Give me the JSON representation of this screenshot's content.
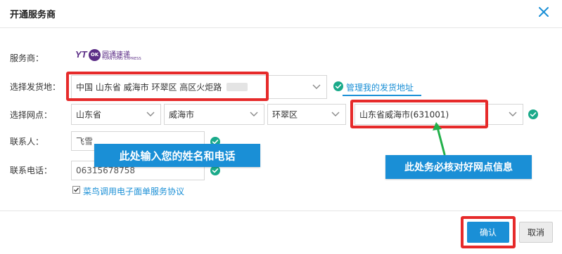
{
  "dialog": {
    "title": "开通服务商",
    "close_icon": "close-icon"
  },
  "form": {
    "provider_label": "服务商：",
    "provider_logo": {
      "mark": "YT",
      "badge": "OK",
      "cn_text": "圆通速递",
      "sub_text": "YUANTONG EXPRESS",
      "brand_color": "#5b2d86"
    },
    "origin_label": "选择发货地：",
    "origin_value": "中国 山东省 威海市 环翠区 高区火炬路",
    "manage_address_link": "管理我的发货地址",
    "branch_label": "选择网点：",
    "branch_province": "山东省",
    "branch_city": "威海市",
    "branch_district": "环翠区",
    "branch_outlet": "山东省威海市(631001)",
    "contact_label": "联系人：",
    "contact_value": "飞雪",
    "phone_label": "联系电话：",
    "phone_value": "06315678758",
    "agreement_checked": true,
    "agreement_text": "菜鸟调用电子面单服务协议"
  },
  "annotations": {
    "name_phone_note": "此处输入您的姓名和电话",
    "verify_branch_note": "此处务必核对好网点信息",
    "highlight_color": "#e62a2a",
    "callout_color": "#1a8fd6"
  },
  "footer": {
    "confirm_label": "确认",
    "cancel_label": "取消"
  },
  "colors": {
    "primary": "#1a8fd6",
    "success": "#1aaa8a",
    "link": "#1a8fd6"
  }
}
